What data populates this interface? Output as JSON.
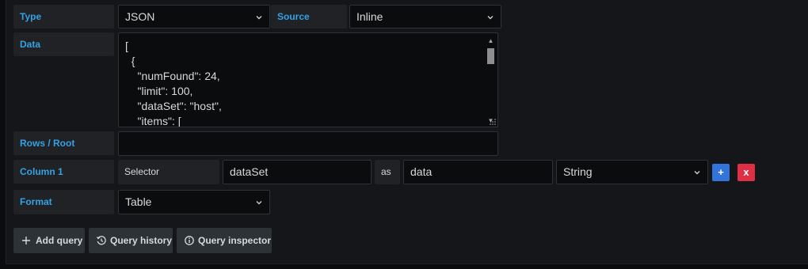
{
  "rows": {
    "type": {
      "label": "Type",
      "value": "JSON",
      "source_label": "Source",
      "source_value": "Inline"
    },
    "data": {
      "label": "Data",
      "lines": "[\n  {\n    \"numFound\": 24,\n    \"limit\": 100,\n    \"dataSet\": \"host\",\n    \"items\": ["
    },
    "rows_root": {
      "label": "Rows / Root",
      "value": ""
    },
    "column": {
      "label": "Column 1",
      "selector_label": "Selector",
      "selector_value": "dataSet",
      "as_label": "as",
      "alias_value": "data",
      "type_value": "String",
      "add_label": "+",
      "remove_label": "x"
    },
    "format": {
      "label": "Format",
      "value": "Table"
    }
  },
  "footer": {
    "add_query": "Add query",
    "query_history": "Query history",
    "query_inspector": "Query inspector"
  },
  "colors": {
    "accent_label": "#33a2e5",
    "add_button": "#3274d9",
    "remove_button": "#e02f44"
  },
  "icons": {
    "dropdown": "chevron-down-icon",
    "add": "plus-icon",
    "history": "history-icon",
    "inspector": "info-circle-icon"
  }
}
